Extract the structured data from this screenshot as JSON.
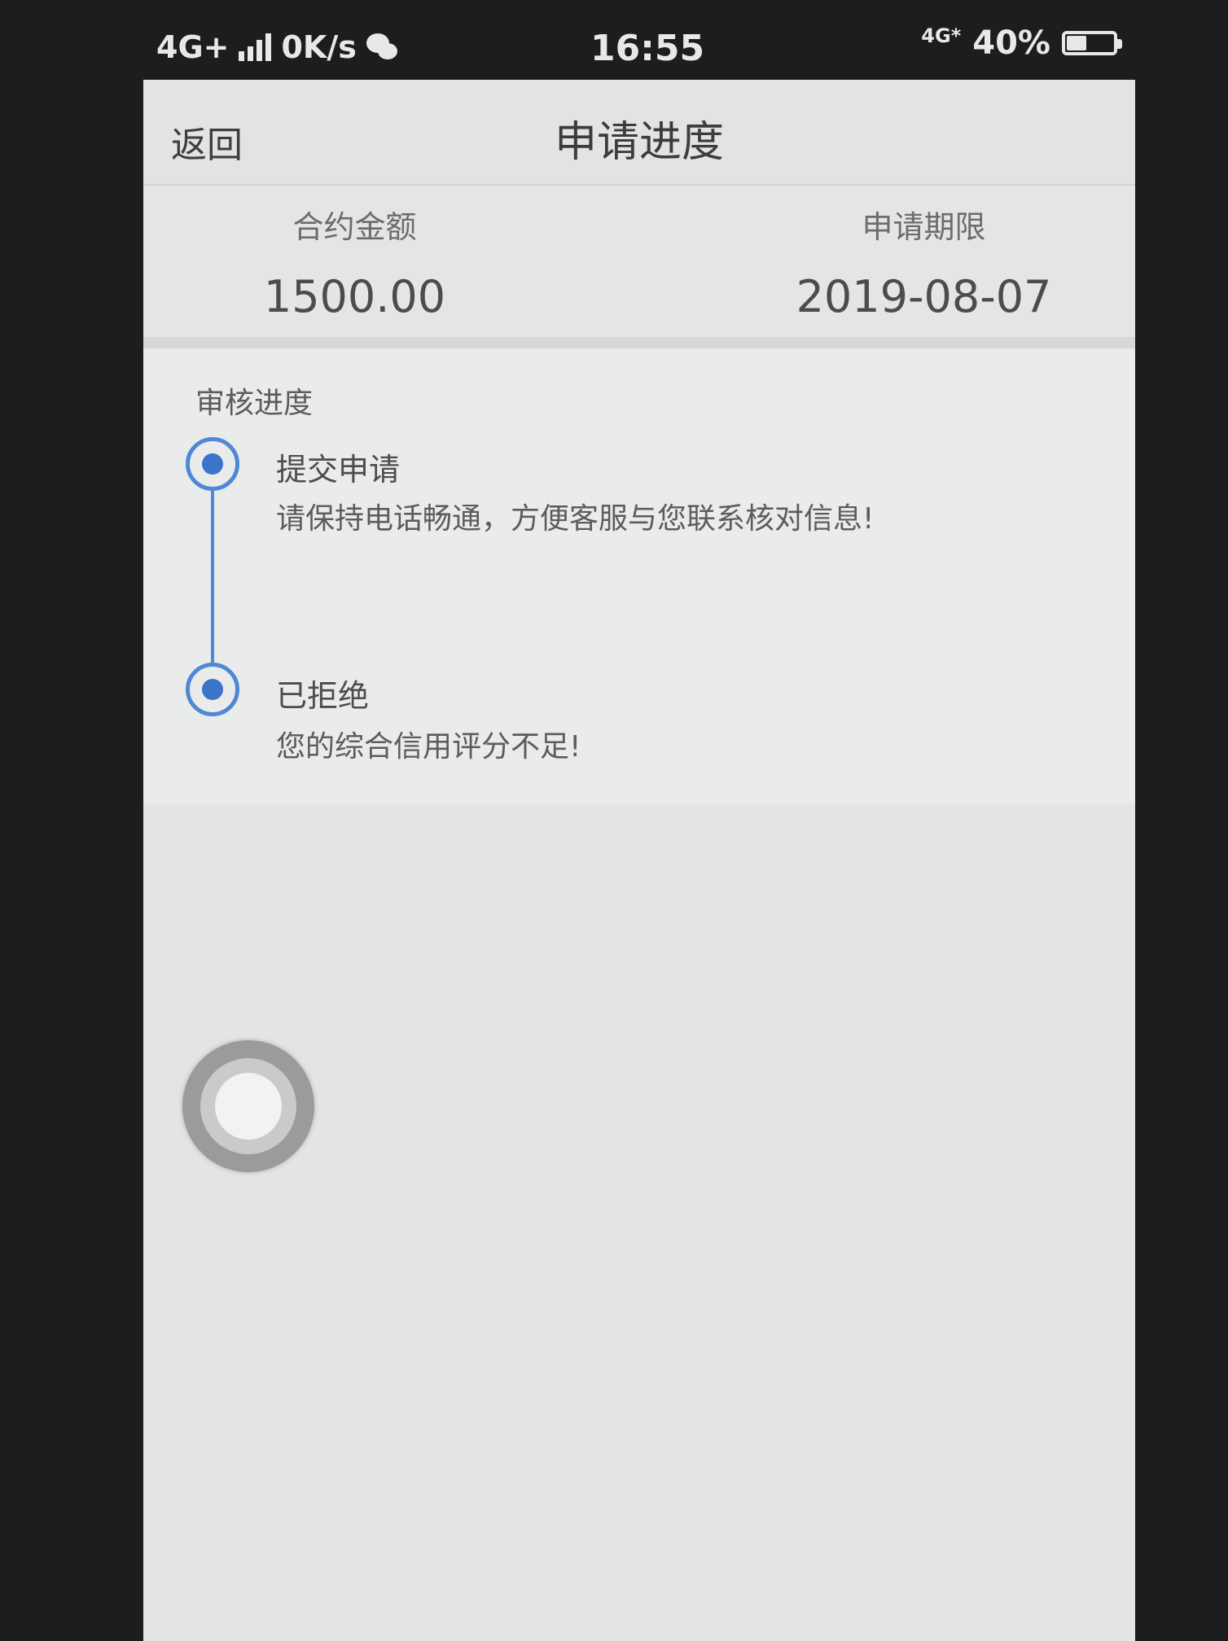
{
  "status_bar": {
    "network": "4G+",
    "speed": "0K/s",
    "time": "16:55",
    "network_right": "4G*",
    "battery": "40%",
    "battery_level": 0.4,
    "icons": [
      "signal-icon",
      "wechat-icon",
      "battery-icon"
    ]
  },
  "nav": {
    "back_label": "返回",
    "title": "申请进度"
  },
  "summary": {
    "amount_label": "合约金额",
    "amount_value": "1500.00",
    "term_label": "申请期限",
    "term_value": "2019-08-07"
  },
  "progress": {
    "title": "审核进度",
    "steps": [
      {
        "title": "提交申请",
        "description": "请保持电话畅通，方便客服与您联系核对信息!"
      },
      {
        "title": "已拒绝",
        "description": "您的综合信用评分不足!"
      }
    ]
  },
  "colors": {
    "accent": "#3b74c9",
    "timeline": "#4f88d4",
    "background": "#e9eaea"
  }
}
